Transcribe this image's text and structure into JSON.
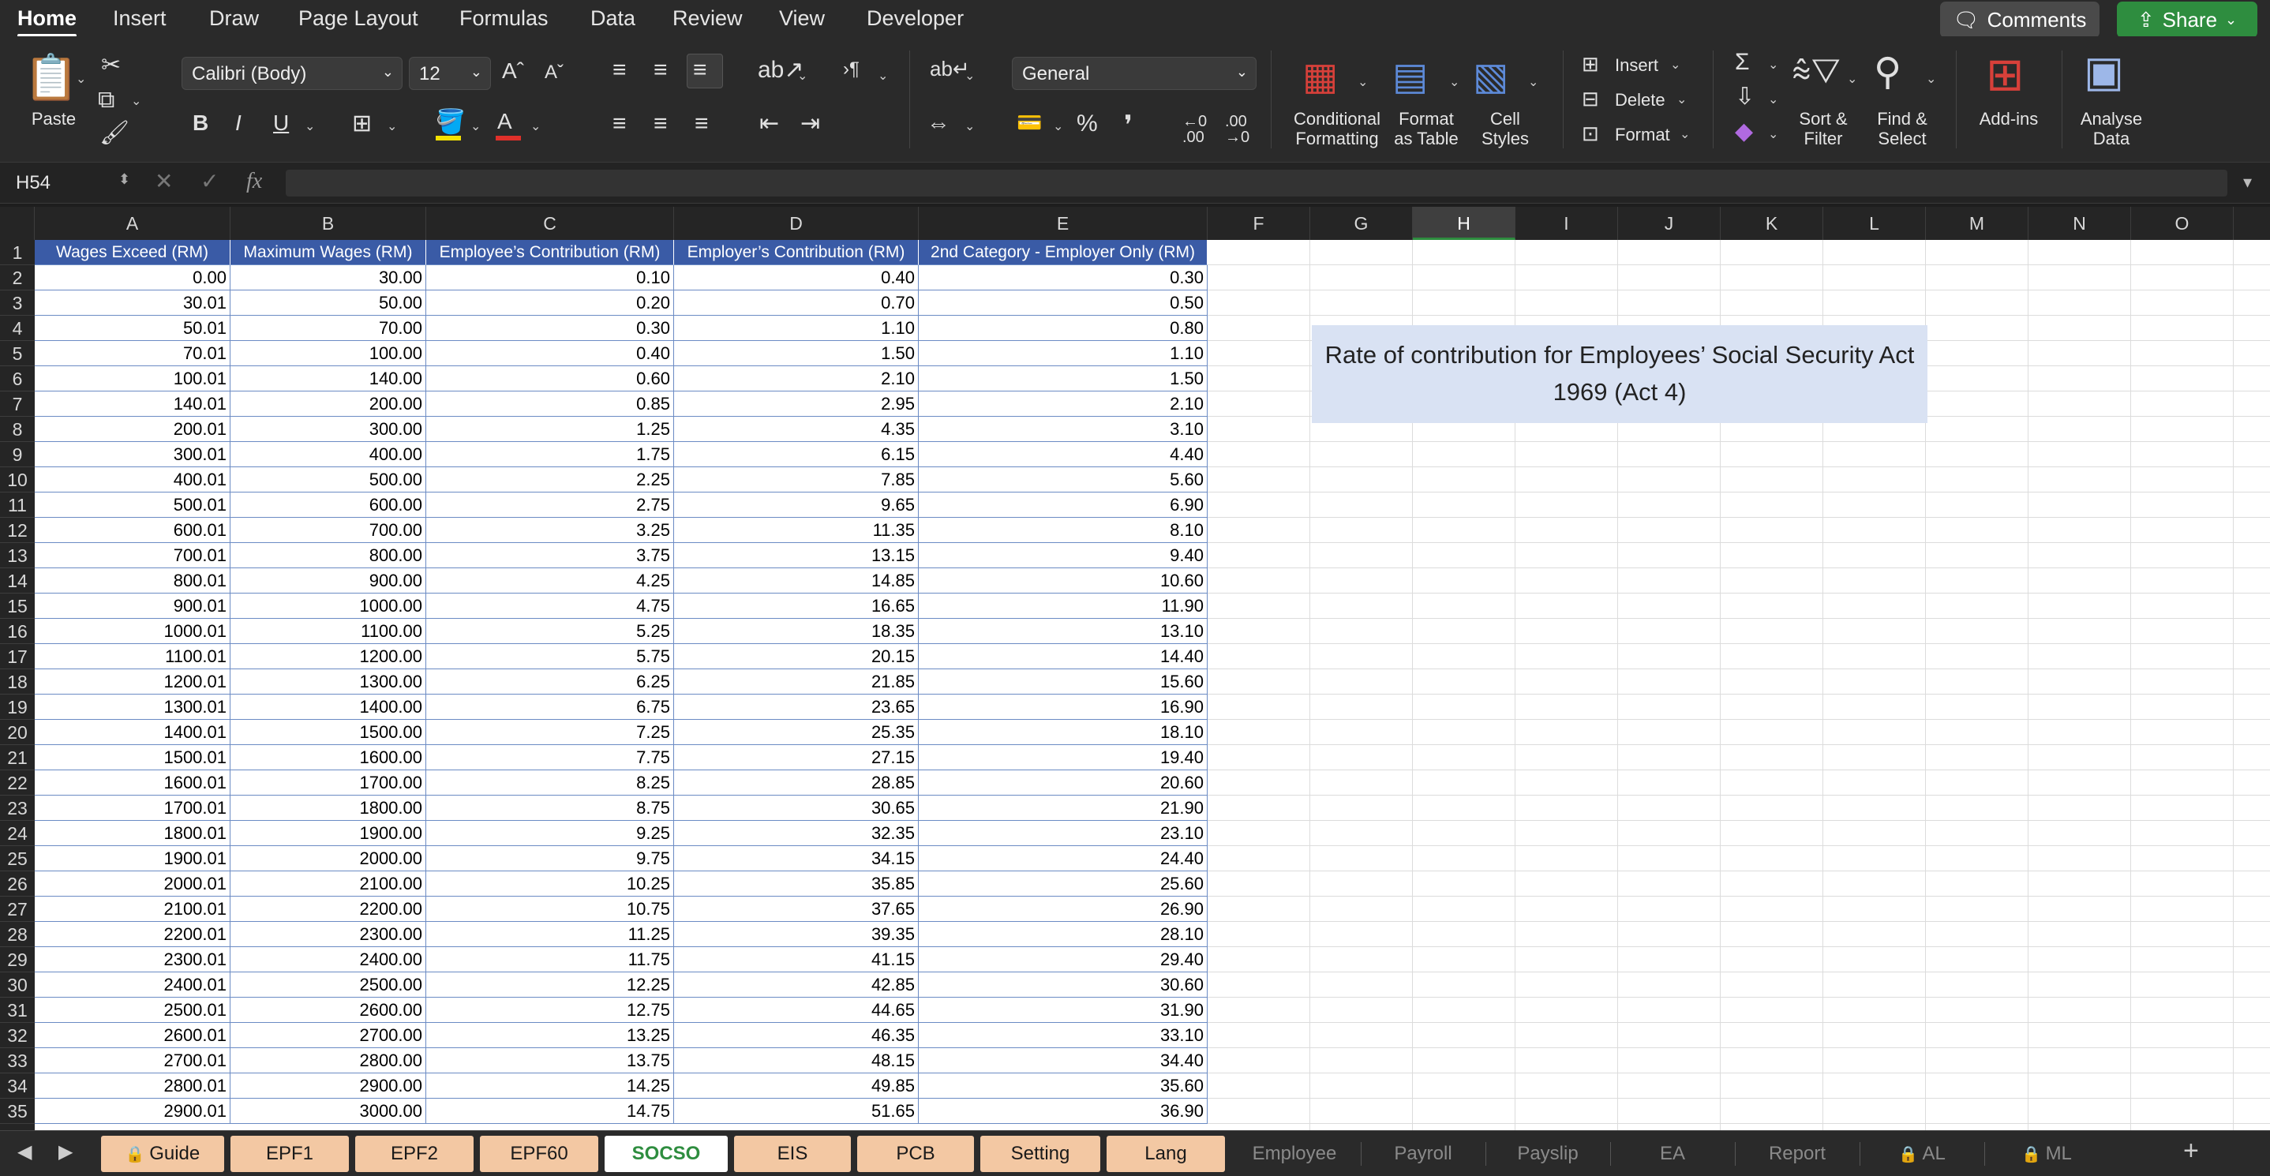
{
  "ribbon_tabs": [
    "Home",
    "Insert",
    "Draw",
    "Page Layout",
    "Formulas",
    "Data",
    "Review",
    "View",
    "Developer"
  ],
  "comments_label": "Comments",
  "share_label": "Share",
  "ribbon": {
    "paste": "Paste",
    "font_name": "Calibri (Body)",
    "font_size": "12",
    "bold": "B",
    "italic": "I",
    "underline": "U",
    "number_format": "General",
    "percent": "%",
    "comma": "❜",
    "conditional_formatting": "Conditional Formatting",
    "format_as_table": "Format as Table",
    "cell_styles": "Cell Styles",
    "insert": "Insert",
    "delete": "Delete",
    "format": "Format",
    "sort_filter": "Sort & Filter",
    "find_select": "Find & Select",
    "add_ins": "Add-ins",
    "analyse_data": "Analyse Data"
  },
  "name_box": "H54",
  "fx": "fx",
  "columns": [
    "A",
    "B",
    "C",
    "D",
    "E",
    "F",
    "G",
    "H",
    "I",
    "J",
    "K",
    "L",
    "M",
    "N",
    "O"
  ],
  "selected_column": "H",
  "row_numbers": [
    "1",
    "2",
    "3",
    "4",
    "5",
    "6",
    "7",
    "8",
    "9",
    "10",
    "11",
    "12",
    "13",
    "14",
    "15",
    "16",
    "17",
    "18",
    "19",
    "20",
    "21",
    "22",
    "23",
    "24",
    "25",
    "26",
    "27",
    "28",
    "29",
    "30",
    "31",
    "32",
    "33",
    "34",
    "35"
  ],
  "table_headers": [
    "Wages Exceed (RM)",
    "Maximum Wages (RM)",
    "Employee’s Contribution (RM)",
    "Employer’s Contribution (RM)",
    "2nd Category - Employer Only (RM)"
  ],
  "table_rows": [
    [
      "0.00",
      "30.00",
      "0.10",
      "0.40",
      "0.30"
    ],
    [
      "30.01",
      "50.00",
      "0.20",
      "0.70",
      "0.50"
    ],
    [
      "50.01",
      "70.00",
      "0.30",
      "1.10",
      "0.80"
    ],
    [
      "70.01",
      "100.00",
      "0.40",
      "1.50",
      "1.10"
    ],
    [
      "100.01",
      "140.00",
      "0.60",
      "2.10",
      "1.50"
    ],
    [
      "140.01",
      "200.00",
      "0.85",
      "2.95",
      "2.10"
    ],
    [
      "200.01",
      "300.00",
      "1.25",
      "4.35",
      "3.10"
    ],
    [
      "300.01",
      "400.00",
      "1.75",
      "6.15",
      "4.40"
    ],
    [
      "400.01",
      "500.00",
      "2.25",
      "7.85",
      "5.60"
    ],
    [
      "500.01",
      "600.00",
      "2.75",
      "9.65",
      "6.90"
    ],
    [
      "600.01",
      "700.00",
      "3.25",
      "11.35",
      "8.10"
    ],
    [
      "700.01",
      "800.00",
      "3.75",
      "13.15",
      "9.40"
    ],
    [
      "800.01",
      "900.00",
      "4.25",
      "14.85",
      "10.60"
    ],
    [
      "900.01",
      "1000.00",
      "4.75",
      "16.65",
      "11.90"
    ],
    [
      "1000.01",
      "1100.00",
      "5.25",
      "18.35",
      "13.10"
    ],
    [
      "1100.01",
      "1200.00",
      "5.75",
      "20.15",
      "14.40"
    ],
    [
      "1200.01",
      "1300.00",
      "6.25",
      "21.85",
      "15.60"
    ],
    [
      "1300.01",
      "1400.00",
      "6.75",
      "23.65",
      "16.90"
    ],
    [
      "1400.01",
      "1500.00",
      "7.25",
      "25.35",
      "18.10"
    ],
    [
      "1500.01",
      "1600.00",
      "7.75",
      "27.15",
      "19.40"
    ],
    [
      "1600.01",
      "1700.00",
      "8.25",
      "28.85",
      "20.60"
    ],
    [
      "1700.01",
      "1800.00",
      "8.75",
      "30.65",
      "21.90"
    ],
    [
      "1800.01",
      "1900.00",
      "9.25",
      "32.35",
      "23.10"
    ],
    [
      "1900.01",
      "2000.00",
      "9.75",
      "34.15",
      "24.40"
    ],
    [
      "2000.01",
      "2100.00",
      "10.25",
      "35.85",
      "25.60"
    ],
    [
      "2100.01",
      "2200.00",
      "10.75",
      "37.65",
      "26.90"
    ],
    [
      "2200.01",
      "2300.00",
      "11.25",
      "39.35",
      "28.10"
    ],
    [
      "2300.01",
      "2400.00",
      "11.75",
      "41.15",
      "29.40"
    ],
    [
      "2400.01",
      "2500.00",
      "12.25",
      "42.85",
      "30.60"
    ],
    [
      "2500.01",
      "2600.00",
      "12.75",
      "44.65",
      "31.90"
    ],
    [
      "2600.01",
      "2700.00",
      "13.25",
      "46.35",
      "33.10"
    ],
    [
      "2700.01",
      "2800.00",
      "13.75",
      "48.15",
      "34.40"
    ],
    [
      "2800.01",
      "2900.00",
      "14.25",
      "49.85",
      "35.60"
    ],
    [
      "2900.01",
      "3000.00",
      "14.75",
      "51.65",
      "36.90"
    ]
  ],
  "note": "Rate of contribution for Employees’ Social Security Act 1969 (Act 4)",
  "sheet_tabs": [
    {
      "label": "Guide",
      "locked": true,
      "style": "colored"
    },
    {
      "label": "EPF1",
      "locked": false,
      "style": "colored"
    },
    {
      "label": "EPF2",
      "locked": false,
      "style": "colored"
    },
    {
      "label": "EPF60",
      "locked": false,
      "style": "colored"
    },
    {
      "label": "SOCSO",
      "locked": false,
      "style": "active"
    },
    {
      "label": "EIS",
      "locked": false,
      "style": "colored"
    },
    {
      "label": "PCB",
      "locked": false,
      "style": "colored"
    },
    {
      "label": "Setting",
      "locked": false,
      "style": "colored"
    },
    {
      "label": "Lang",
      "locked": false,
      "style": "colored"
    },
    {
      "label": "Employee",
      "locked": false,
      "style": "plain"
    },
    {
      "label": "Payroll",
      "locked": false,
      "style": "plain"
    },
    {
      "label": "Payslip",
      "locked": false,
      "style": "plain"
    },
    {
      "label": "EA",
      "locked": false,
      "style": "plain"
    },
    {
      "label": "Report",
      "locked": false,
      "style": "plain"
    },
    {
      "label": "AL",
      "locked": true,
      "style": "plain"
    },
    {
      "label": "ML",
      "locked": true,
      "style": "plain"
    }
  ],
  "colors": {
    "header_fill": "#3a5ba6",
    "note_fill": "#d9e2f3",
    "active_tab": "#2e8d3f",
    "tab_fill": "#f3c8a3"
  }
}
